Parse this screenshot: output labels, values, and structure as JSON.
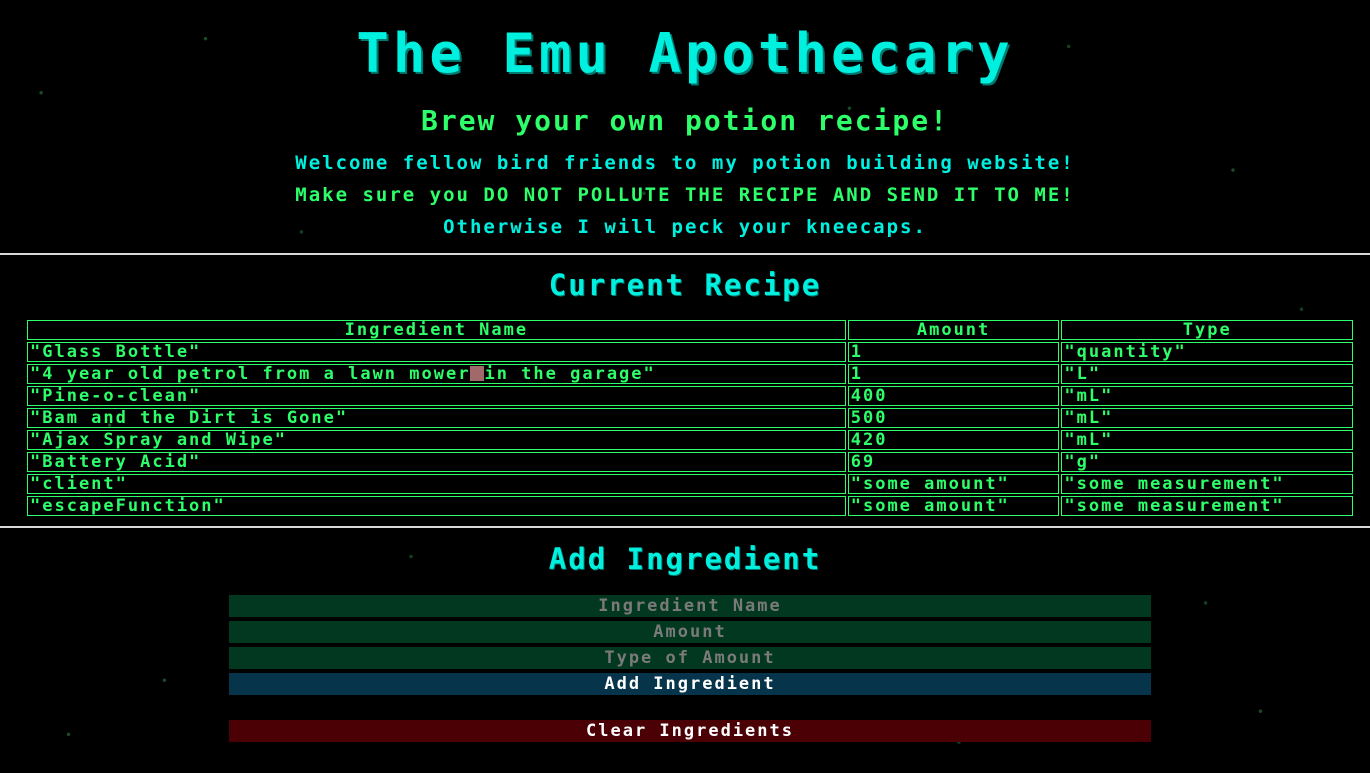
{
  "header": {
    "title": "The Emu Apothecary",
    "subtitle": "Brew your own potion recipe!",
    "intro_lines": [
      "Welcome fellow bird friends to my potion building website!",
      "Make sure you DO NOT POLLUTE THE RECIPE AND SEND IT TO ME!",
      "Otherwise I will peck your kneecaps."
    ]
  },
  "recipe": {
    "title": "Current Recipe",
    "columns": [
      "Ingredient Name",
      "Amount",
      "Type"
    ],
    "rows": [
      {
        "name": "\"Glass Bottle\"",
        "amount": "1",
        "type": "\"quantity\""
      },
      {
        "name_part1": "\"4 year old petrol from a lawn mower",
        "name_part2": "in the garage\"",
        "amount": "1",
        "type": "\"L\""
      },
      {
        "name": "\"Pine-o-clean\"",
        "amount": "400",
        "type": "\"mL\""
      },
      {
        "name": "\"Bam and the Dirt is Gone\"",
        "amount": "500",
        "type": "\"mL\""
      },
      {
        "name": "\"Ajax Spray and Wipe\"",
        "amount": "420",
        "type": "\"mL\""
      },
      {
        "name": "\"Battery Acid\"",
        "amount": "69",
        "type": "\"g\""
      },
      {
        "name": "\"client\"",
        "amount": "\"some amount\"",
        "type": "\"some measurement\""
      },
      {
        "name": "\"escapeFunction\"",
        "amount": "\"some amount\"",
        "type": "\"some measurement\""
      }
    ]
  },
  "add_form": {
    "title": "Add Ingredient",
    "name_placeholder": "Ingredient Name",
    "amount_placeholder": "Amount",
    "type_placeholder": "Type of Amount",
    "add_button": "Add Ingredient",
    "clear_button": "Clear Ingredients"
  },
  "colors": {
    "cyan": "#00f0e0",
    "green": "#2dff6a",
    "input_bg": "#02381f",
    "add_button_bg": "#06344a",
    "clear_button_bg": "#4a0004"
  }
}
